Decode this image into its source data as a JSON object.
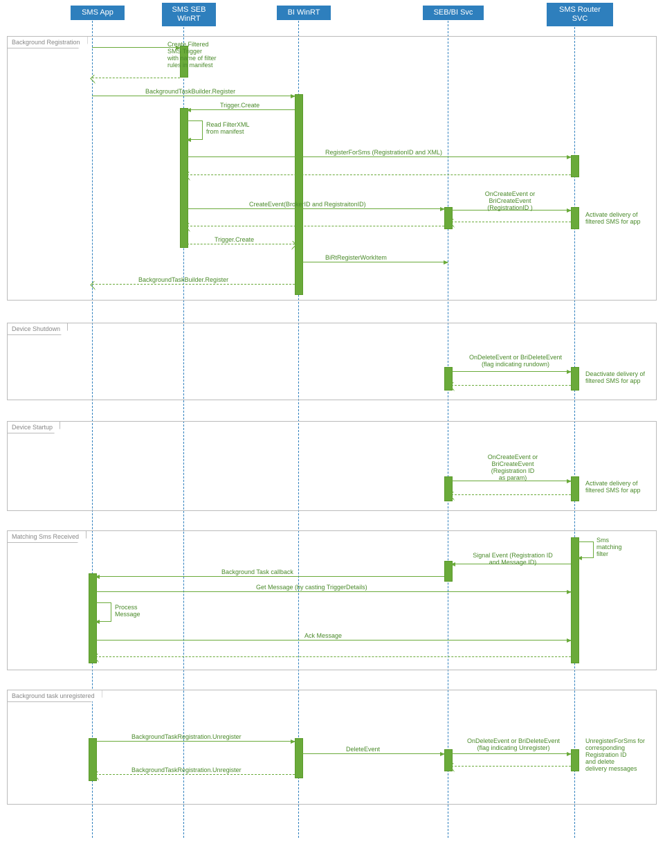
{
  "actors": {
    "a1": "SMS App",
    "a2": "SMS SEB\nWinRT",
    "a3": "BI WinRT",
    "a4": "SEB/BI Svc",
    "a5": "SMS Router\nSVC"
  },
  "frames": {
    "f1": "Background Registration",
    "f2": "Device Shutdown",
    "f3": "Device Startup",
    "f4": "Matching Sms Received",
    "f5": "Background task unregistered"
  },
  "labels": {
    "l1": "Create Filtered\nSMS Trigger\nwith name of filter\nrules in manifest",
    "l2": "BackgroundTaskBuilder.Register",
    "l3": "Trigger.Create",
    "l4": "Read FilterXML\nfrom manifest",
    "l5": "RegisterForSms (RegistrationID and XML)",
    "l6": "CreateEvent(BrokerID and RegistraitonID)",
    "l7": "OnCreateEvent or\nBriCreateEvent\n(RegistrationID )",
    "l8": "Activate delivery of\nfiltered SMS for app",
    "l9": "Trigger.Create",
    "l10": "BiRtRegisterWorkItem",
    "l11": "BackgroundTaskBuilder.Register",
    "l12": "OnDeleteEvent or BriDeleteEvent\n(flag indicating rundown)",
    "l13": "Deactivate delivery of\nfiltered SMS for app",
    "l14": "OnCreateEvent or\nBriCreateEvent\n(Registration ID\nas param)",
    "l15": "Activate delivery of\nfiltered SMS for app",
    "l16": "Sms\nmatching\nfilter",
    "l17": "Signal Event (Registration ID\nand Message ID)",
    "l18": "Background Task callback",
    "l19": "Get Message (by casting TriggerDetails)",
    "l20": "Process\nMessage",
    "l21": "Ack Message",
    "l22": "BackgroundTaskRegistration.Unregister",
    "l23": "DeleteEvent",
    "l24": "OnDeleteEvent or BriDeleteEvent\n(flag indicating Unregister)",
    "l25": "UnregisterForSms for\ncorresponding\nRegistration ID\nand delete\ndelivery messages",
    "l26": "BackgroundTaskRegistration.Unregister"
  },
  "chart_data": {
    "type": "sequence-diagram",
    "participants": [
      "SMS App",
      "SMS SEB WinRT",
      "BI WinRT",
      "SEB/BI Svc",
      "SMS Router SVC"
    ],
    "fragments": [
      {
        "name": "Background Registration",
        "messages": [
          {
            "from": "SMS App",
            "to": "SMS SEB WinRT",
            "label": "Create Filtered SMS Trigger with name of filter rules in manifest",
            "sync": true
          },
          {
            "from": "SMS SEB WinRT",
            "to": "SMS App",
            "label": "",
            "return": true
          },
          {
            "from": "SMS App",
            "to": "BI WinRT",
            "label": "BackgroundTaskBuilder.Register",
            "sync": true
          },
          {
            "from": "BI WinRT",
            "to": "SMS SEB WinRT",
            "label": "Trigger.Create",
            "sync": true
          },
          {
            "from": "SMS SEB WinRT",
            "to": "SMS SEB WinRT",
            "label": "Read FilterXML from manifest",
            "self": true
          },
          {
            "from": "SMS SEB WinRT",
            "to": "SMS Router SVC",
            "label": "RegisterForSms (RegistrationID and XML)",
            "sync": true
          },
          {
            "from": "SMS Router SVC",
            "to": "SMS SEB WinRT",
            "label": "",
            "return": true
          },
          {
            "from": "SMS SEB WinRT",
            "to": "SEB/BI Svc",
            "label": "CreateEvent(BrokerID and RegistraitonID)",
            "sync": true
          },
          {
            "from": "SEB/BI Svc",
            "to": "SMS Router SVC",
            "label": "OnCreateEvent or BriCreateEvent (RegistrationID)",
            "sync": true,
            "note": "Activate delivery of filtered SMS for app"
          },
          {
            "from": "SMS Router SVC",
            "to": "SEB/BI Svc",
            "label": "",
            "return": true
          },
          {
            "from": "SEB/BI Svc",
            "to": "SMS SEB WinRT",
            "label": "",
            "return": true
          },
          {
            "from": "SMS SEB WinRT",
            "to": "BI WinRT",
            "label": "Trigger.Create",
            "return": true
          },
          {
            "from": "BI WinRT",
            "to": "SEB/BI Svc",
            "label": "BiRtRegisterWorkItem",
            "sync": true
          },
          {
            "from": "BI WinRT",
            "to": "SMS App",
            "label": "BackgroundTaskBuilder.Register",
            "return": true
          }
        ]
      },
      {
        "name": "Device Shutdown",
        "messages": [
          {
            "from": "SEB/BI Svc",
            "to": "SMS Router SVC",
            "label": "OnDeleteEvent or BriDeleteEvent (flag indicating rundown)",
            "sync": true,
            "note": "Deactivate delivery of filtered SMS for app"
          },
          {
            "from": "SMS Router SVC",
            "to": "SEB/BI Svc",
            "label": "",
            "return": true
          }
        ]
      },
      {
        "name": "Device Startup",
        "messages": [
          {
            "from": "SEB/BI Svc",
            "to": "SMS Router SVC",
            "label": "OnCreateEvent or BriCreateEvent (Registration ID as param)",
            "sync": true,
            "note": "Activate delivery of filtered SMS for app"
          },
          {
            "from": "SMS Router SVC",
            "to": "SEB/BI Svc",
            "label": "",
            "return": true
          }
        ]
      },
      {
        "name": "Matching Sms Received",
        "messages": [
          {
            "from": "SMS Router SVC",
            "to": "SMS Router SVC",
            "label": "Sms matching filter",
            "self": true
          },
          {
            "from": "SMS Router SVC",
            "to": "SEB/BI Svc",
            "label": "Signal Event (Registration ID and Message ID)",
            "sync": true
          },
          {
            "from": "SEB/BI Svc",
            "to": "SMS App",
            "label": "Background Task callback",
            "sync": true
          },
          {
            "from": "SMS App",
            "to": "SMS Router SVC",
            "label": "Get Message (by casting TriggerDetails)",
            "sync": true
          },
          {
            "from": "SMS App",
            "to": "SMS App",
            "label": "Process Message",
            "self": true
          },
          {
            "from": "SMS App",
            "to": "SMS Router SVC",
            "label": "Ack Message",
            "sync": true
          },
          {
            "from": "SMS Router SVC",
            "to": "SMS App",
            "label": "",
            "return": true
          }
        ]
      },
      {
        "name": "Background task unregistered",
        "messages": [
          {
            "from": "SMS App",
            "to": "BI WinRT",
            "label": "BackgroundTaskRegistration.Unregister",
            "sync": true
          },
          {
            "from": "BI WinRT",
            "to": "SEB/BI Svc",
            "label": "DeleteEvent",
            "sync": true
          },
          {
            "from": "SEB/BI Svc",
            "to": "SMS Router SVC",
            "label": "OnDeleteEvent or BriDeleteEvent (flag indicating Unregister)",
            "sync": true,
            "note": "UnregisterForSms for corresponding Registration ID and delete delivery messages"
          },
          {
            "from": "SMS Router SVC",
            "to": "SEB/BI Svc",
            "label": "",
            "return": true
          },
          {
            "from": "BI WinRT",
            "to": "SMS App",
            "label": "BackgroundTaskRegistration.Unregister",
            "return": true
          }
        ]
      }
    ]
  }
}
